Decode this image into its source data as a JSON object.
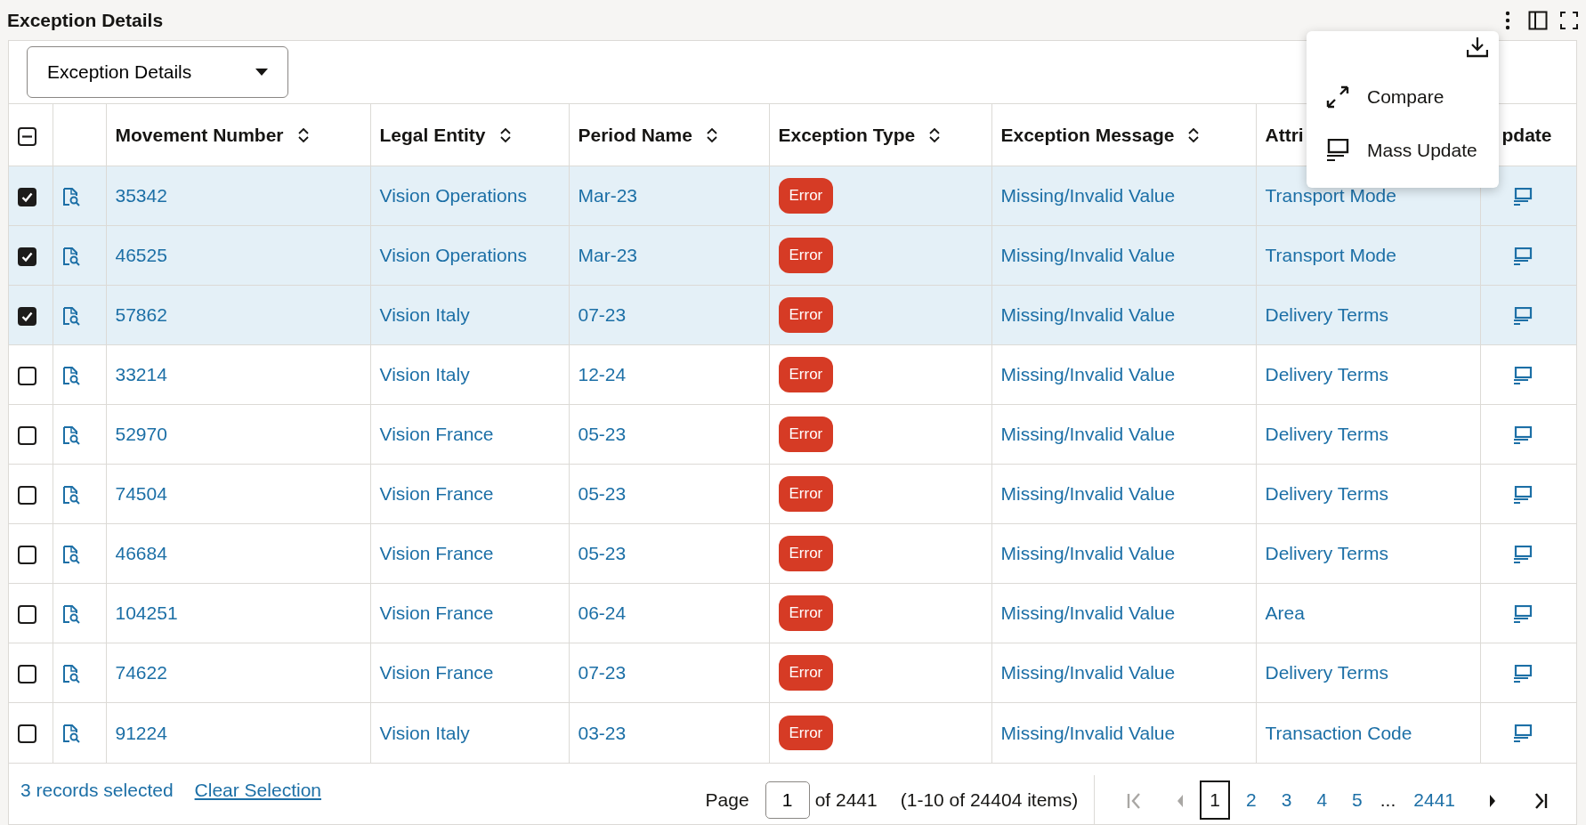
{
  "title": "Exception Details",
  "view_selector": {
    "value": "Exception Details"
  },
  "select_all": {
    "indeterminate": true
  },
  "columns": [
    {
      "label": "Movement Number",
      "sortable": true
    },
    {
      "label": "Legal Entity",
      "sortable": true
    },
    {
      "label": "Period Name",
      "sortable": true
    },
    {
      "label": "Exception Type",
      "sortable": true
    },
    {
      "label": "Exception Message",
      "sortable": true
    },
    {
      "label": "Attri",
      "sortable": false
    },
    {
      "label": "pdate",
      "sortable": false,
      "kind": "update"
    }
  ],
  "rows": [
    {
      "selected": true,
      "movement_number": "35342",
      "legal_entity": "Vision Operations",
      "period_name": "Mar-23",
      "exception_type": "Error",
      "exception_message": "Missing/Invalid Value",
      "attribute": "Transport Mode"
    },
    {
      "selected": true,
      "movement_number": "46525",
      "legal_entity": "Vision Operations",
      "period_name": "Mar-23",
      "exception_type": "Error",
      "exception_message": "Missing/Invalid Value",
      "attribute": "Transport Mode"
    },
    {
      "selected": true,
      "movement_number": "57862",
      "legal_entity": "Vision Italy",
      "period_name": "07-23",
      "exception_type": "Error",
      "exception_message": "Missing/Invalid Value",
      "attribute": "Delivery Terms"
    },
    {
      "selected": false,
      "movement_number": "33214",
      "legal_entity": "Vision Italy",
      "period_name": "12-24",
      "exception_type": "Error",
      "exception_message": "Missing/Invalid Value",
      "attribute": "Delivery Terms"
    },
    {
      "selected": false,
      "movement_number": "52970",
      "legal_entity": "Vision France",
      "period_name": "05-23",
      "exception_type": "Error",
      "exception_message": "Missing/Invalid Value",
      "attribute": "Delivery Terms"
    },
    {
      "selected": false,
      "movement_number": "74504",
      "legal_entity": "Vision France",
      "period_name": "05-23",
      "exception_type": "Error",
      "exception_message": "Missing/Invalid Value",
      "attribute": "Delivery Terms"
    },
    {
      "selected": false,
      "movement_number": "46684",
      "legal_entity": "Vision France",
      "period_name": "05-23",
      "exception_type": "Error",
      "exception_message": "Missing/Invalid Value",
      "attribute": "Delivery Terms"
    },
    {
      "selected": false,
      "movement_number": "104251",
      "legal_entity": "Vision France",
      "period_name": "06-24",
      "exception_type": "Error",
      "exception_message": "Missing/Invalid Value",
      "attribute": "Area"
    },
    {
      "selected": false,
      "movement_number": "74622",
      "legal_entity": "Vision France",
      "period_name": "07-23",
      "exception_type": "Error",
      "exception_message": "Missing/Invalid Value",
      "attribute": "Delivery Terms"
    },
    {
      "selected": false,
      "movement_number": "91224",
      "legal_entity": "Vision Italy",
      "period_name": "03-23",
      "exception_type": "Error",
      "exception_message": "Missing/Invalid Value",
      "attribute": "Transaction Code"
    }
  ],
  "menu": {
    "items": [
      {
        "kind": "compare",
        "label": "Compare"
      },
      {
        "kind": "mass-update",
        "label": "Mass Update"
      }
    ]
  },
  "footer": {
    "selection_count": "3 records selected",
    "clear_selection": "Clear Selection"
  },
  "pagination": {
    "page_label": "Page",
    "page_value": "1",
    "page_total": "of 2441",
    "range": "(1-10 of 24404 items)",
    "pages": [
      {
        "kind": "page",
        "label": "1",
        "selected": true
      },
      {
        "kind": "page",
        "label": "2",
        "selected": false
      },
      {
        "kind": "page",
        "label": "3",
        "selected": false
      },
      {
        "kind": "page",
        "label": "4",
        "selected": false
      },
      {
        "kind": "page",
        "label": "5",
        "selected": false
      },
      {
        "kind": "ellipsis",
        "label": "..."
      },
      {
        "kind": "page",
        "label": "2441",
        "selected": false
      }
    ],
    "nav": [
      {
        "kind": "first",
        "disabled": true
      },
      {
        "kind": "previous",
        "disabled": true
      },
      {
        "kind": "next",
        "disabled": false
      },
      {
        "kind": "last",
        "disabled": false
      }
    ]
  }
}
